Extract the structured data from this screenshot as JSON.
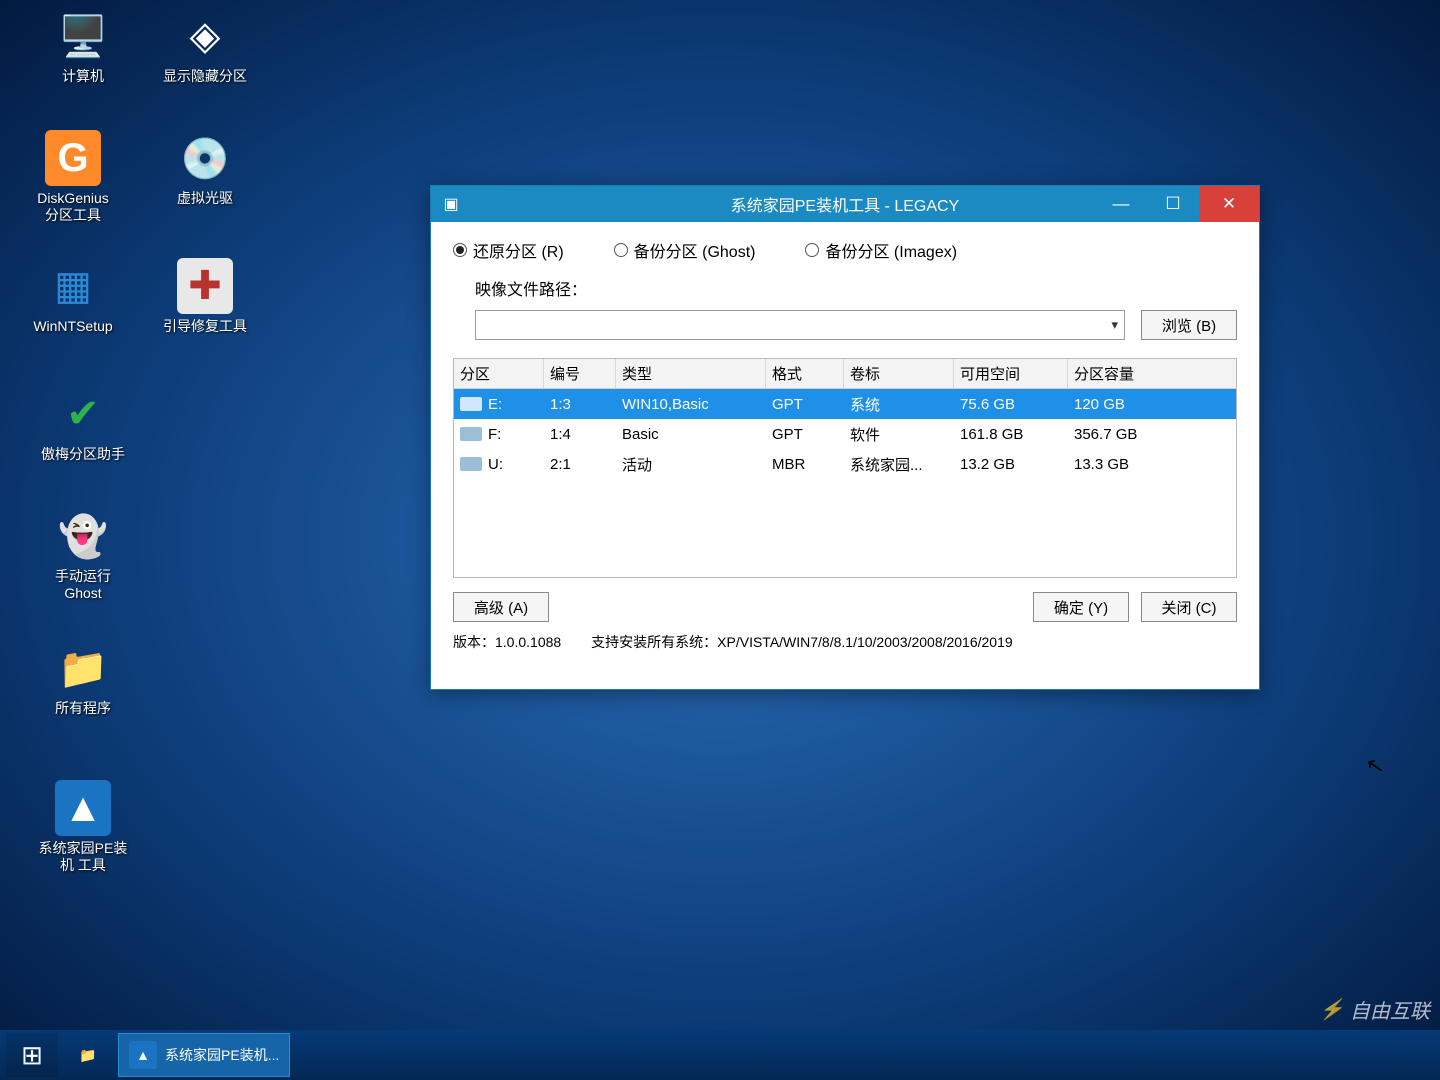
{
  "desktop": {
    "icons": [
      {
        "label": "计算机",
        "glyph": "🖥️",
        "color": "#6aa7d6"
      },
      {
        "label": "显示隐藏分区",
        "glyph": "◈",
        "color": "#d9d9d9"
      },
      {
        "label": "DiskGenius\n分区工具",
        "glyph": "G",
        "color": "#ff8a2a"
      },
      {
        "label": "虚拟光驱",
        "glyph": "💿",
        "color": "#aab2bd"
      },
      {
        "label": "WinNTSetup",
        "glyph": "▦",
        "color": "#2a8ad6"
      },
      {
        "label": "引导修复工具",
        "glyph": "✚",
        "color": "#e8e8e8"
      },
      {
        "label": "傲梅分区助手",
        "glyph": "✔",
        "color": "#2fb24a"
      },
      {
        "label": "手动运行\nGhost",
        "glyph": "👻",
        "color": "#bfe0f5"
      },
      {
        "label": "所有程序",
        "glyph": "📁",
        "color": "#e8c24a"
      },
      {
        "label": "系统家园PE装\n机 工具",
        "glyph": "▲",
        "color": "#1a74c2"
      }
    ]
  },
  "taskbar": {
    "start_glyph": "⊞",
    "items": [
      {
        "label": "",
        "glyph": "📁",
        "active": false
      },
      {
        "label": "系统家园PE装机...",
        "glyph": "▲",
        "active": true
      }
    ]
  },
  "window": {
    "title": "系统家园PE装机工具 - LEGACY",
    "min_glyph": "—",
    "max_glyph": "☐",
    "close_glyph": "✕",
    "radios": {
      "restore": "还原分区 (R)",
      "backup_ghost": "备份分区 (Ghost)",
      "backup_imagex": "备份分区 (Imagex)"
    },
    "path_label": "映像文件路径：",
    "path_value": "",
    "browse_btn": "浏览 (B)",
    "grid": {
      "headers": [
        "分区",
        "编号",
        "类型",
        "格式",
        "卷标",
        "可用空间",
        "分区容量"
      ],
      "rows": [
        {
          "drive": "E:",
          "num": "1:3",
          "type": "WIN10,Basic",
          "fmt": "GPT",
          "label": "系统",
          "free": "75.6 GB",
          "total": "120 GB",
          "selected": true
        },
        {
          "drive": "F:",
          "num": "1:4",
          "type": "Basic",
          "fmt": "GPT",
          "label": "软件",
          "free": "161.8 GB",
          "total": "356.7 GB",
          "selected": false
        },
        {
          "drive": "U:",
          "num": "2:1",
          "type": "活动",
          "fmt": "MBR",
          "label": "系统家园...",
          "free": "13.2 GB",
          "total": "13.3 GB",
          "selected": false
        }
      ]
    },
    "advanced_btn": "高级 (A)",
    "ok_btn": "确定 (Y)",
    "close_btn": "关闭 (C)",
    "version_label": "版本：1.0.0.1088",
    "support_label": "支持安装所有系统：XP/VISTA/WIN7/8/8.1/10/2003/2008/2016/2019"
  },
  "watermark": "自由互联"
}
